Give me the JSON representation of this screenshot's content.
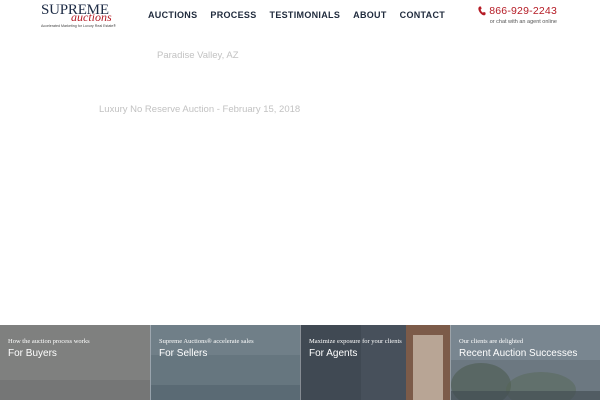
{
  "brand": {
    "name_top": "SUPREME",
    "name_script": "auctions",
    "tagline": "Accelerated Marketing for Luxury Real Estate®",
    "accent_color": "#b51b25",
    "navy_color": "#1c2a44"
  },
  "nav": {
    "items": [
      {
        "label": "AUCTIONS"
      },
      {
        "label": "PROCESS"
      },
      {
        "label": "TESTIMONIALS"
      },
      {
        "label": "ABOUT"
      },
      {
        "label": "CONTACT"
      }
    ]
  },
  "contact": {
    "icon": "phone-icon",
    "phone": "866-929-2243",
    "chat_text": "or chat with an agent online"
  },
  "hero": {
    "location": "Paradise Valley, AZ",
    "auction_line": "Luxury No Reserve Auction - February 15, 2018"
  },
  "tiles": [
    {
      "kicker": "How the auction process works",
      "title": "For Buyers"
    },
    {
      "kicker": "Supreme Auctions® accelerate sales",
      "title": "For Sellers"
    },
    {
      "kicker": "Maximize exposure for your clients",
      "title": "For Agents"
    },
    {
      "kicker": "Our clients are delighted",
      "title": "Recent Auction Successes"
    }
  ]
}
